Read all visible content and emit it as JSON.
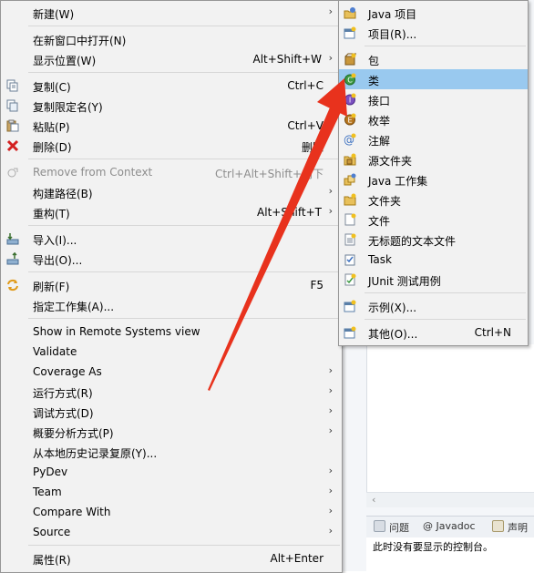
{
  "context_menu": {
    "items": [
      {
        "label": "新建(W)",
        "shortcut": "",
        "arrow": true
      },
      {
        "label": "在新窗口中打开(N)",
        "shortcut": ""
      },
      {
        "label": "显示位置(W)",
        "shortcut": "Alt+Shift+W",
        "arrow": true
      },
      {
        "label": "复制(C)",
        "shortcut": "Ctrl+C"
      },
      {
        "label": "复制限定名(Y)",
        "shortcut": ""
      },
      {
        "label": "粘贴(P)",
        "shortcut": "Ctrl+V"
      },
      {
        "label": "删除(D)",
        "shortcut": "删除"
      },
      {
        "label": "Remove from Context",
        "shortcut": "Ctrl+Alt+Shift+向下",
        "disabled": true
      },
      {
        "label": "构建路径(B)",
        "shortcut": "",
        "arrow": true
      },
      {
        "label": "重构(T)",
        "shortcut": "Alt+Shift+T",
        "arrow": true
      },
      {
        "label": "导入(I)...",
        "shortcut": ""
      },
      {
        "label": "导出(O)...",
        "shortcut": ""
      },
      {
        "label": "刷新(F)",
        "shortcut": "F5"
      },
      {
        "label": "指定工作集(A)...",
        "shortcut": ""
      },
      {
        "label": "Show in Remote Systems view",
        "shortcut": ""
      },
      {
        "label": "Validate",
        "shortcut": ""
      },
      {
        "label": "Coverage As",
        "shortcut": "",
        "arrow": true
      },
      {
        "label": "运行方式(R)",
        "shortcut": "",
        "arrow": true
      },
      {
        "label": "调试方式(D)",
        "shortcut": "",
        "arrow": true
      },
      {
        "label": "概要分析方式(P)",
        "shortcut": "",
        "arrow": true
      },
      {
        "label": "从本地历史记录复原(Y)...",
        "shortcut": ""
      },
      {
        "label": "PyDev",
        "shortcut": "",
        "arrow": true
      },
      {
        "label": "Team",
        "shortcut": "",
        "arrow": true
      },
      {
        "label": "Compare With",
        "shortcut": "",
        "arrow": true
      },
      {
        "label": "Source",
        "shortcut": "",
        "arrow": true
      },
      {
        "label": "属性(R)",
        "shortcut": "Alt+Enter"
      }
    ]
  },
  "new_submenu": {
    "items": [
      {
        "label": "Java 项目",
        "shortcut": ""
      },
      {
        "label": "项目(R)...",
        "shortcut": ""
      },
      {
        "label": "包",
        "shortcut": ""
      },
      {
        "label": "类",
        "shortcut": "",
        "highlighted": true
      },
      {
        "label": "接口",
        "shortcut": ""
      },
      {
        "label": "枚举",
        "shortcut": ""
      },
      {
        "label": "注解",
        "shortcut": ""
      },
      {
        "label": "源文件夹",
        "shortcut": ""
      },
      {
        "label": "Java 工作集",
        "shortcut": ""
      },
      {
        "label": "文件夹",
        "shortcut": ""
      },
      {
        "label": "文件",
        "shortcut": ""
      },
      {
        "label": "无标题的文本文件",
        "shortcut": ""
      },
      {
        "label": "Task",
        "shortcut": ""
      },
      {
        "label": "JUnit 测试用例",
        "shortcut": ""
      },
      {
        "label": "示例(X)...",
        "shortcut": ""
      },
      {
        "label": "其他(O)...",
        "shortcut": "Ctrl+N"
      }
    ]
  },
  "background": {
    "tabs": [
      {
        "label": "问题"
      },
      {
        "label": "@ Javadoc"
      },
      {
        "label": "声明"
      }
    ],
    "console_text": "此时没有要显示的控制台。"
  },
  "colors": {
    "menu_bg": "#f2f2f2",
    "highlight": "#99c9ef",
    "annotation_arrow": "#e8321d"
  }
}
